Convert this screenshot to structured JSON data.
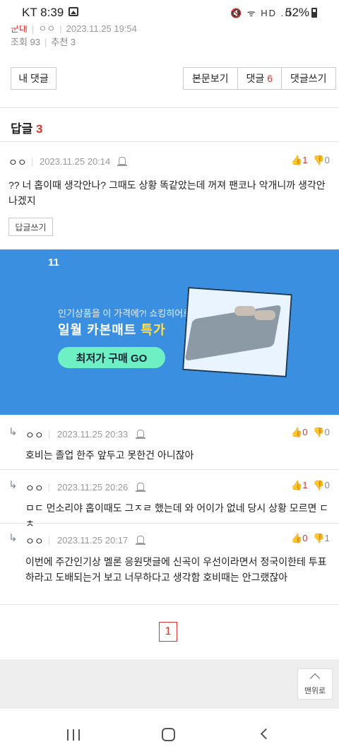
{
  "status_bar": {
    "carrier_time": "KT 8:39",
    "icons": "🔇 ᯤ HD .ıl",
    "battery": "52%"
  },
  "post_meta": {
    "board": "군대",
    "author": "ㅇㅇ",
    "date": "2023.11.25 19:54",
    "views": "조회 93",
    "recommends": "추천 3"
  },
  "toolbar": {
    "my_comments": "내 댓글",
    "view_post": "본문보기",
    "comments_label": "댓글",
    "comments_count": "6",
    "write_comment": "댓글쓰기"
  },
  "section": {
    "title": "답글",
    "count": "3"
  },
  "comments": [
    {
      "author": "ㅇㅇ",
      "date": "2023.11.25 20:14",
      "up": "1",
      "down": "0",
      "text": "?? 너 홉이때 생각안나? 그때도 상황 똑같았는데 꺼져 팬코나 악개니까 생각안나겠지",
      "reply_label": "답글쓰기"
    },
    {
      "author": "ㅇㅇ",
      "date": "2023.11.25 20:33",
      "up": "0",
      "down": "0",
      "text": "호비는 졸업 한주 앞두고 못한건 아니잖아"
    },
    {
      "author": "ㅇㅇ",
      "date": "2023.11.25 20:26",
      "up": "1",
      "down": "0",
      "text": "ㅁㄷ 먼소리야 홉이때도 그ㅈㄹ 했는데 와 어이가 없네 당시 상황 모르면 ㄷㅊ"
    },
    {
      "author": "ㅇㅇ",
      "date": "2023.11.25 20:17",
      "up": "0",
      "down": "1",
      "text": "이번에 주간인기상 멜론 응원댓글에 신곡이 우선이라면서 정국이한테 투표하라고 도배되는거 보고 너무하다고 생각함 호비때는 안그랬잖아"
    }
  ],
  "ad": {
    "logo": "11",
    "sub": "인기상품을 이 가격에?! 쇼킹히어로가",
    "headline_main": "일월 카본매트",
    "headline_accent": "특가",
    "cta": "최저가 구매 GO"
  },
  "pagination": {
    "current": "1"
  },
  "back_to_top": "맨위로",
  "colors": {
    "accent_red": "#dd3333",
    "ad_blue": "#3b8fe0",
    "cta_mint": "#6ff0c4"
  }
}
